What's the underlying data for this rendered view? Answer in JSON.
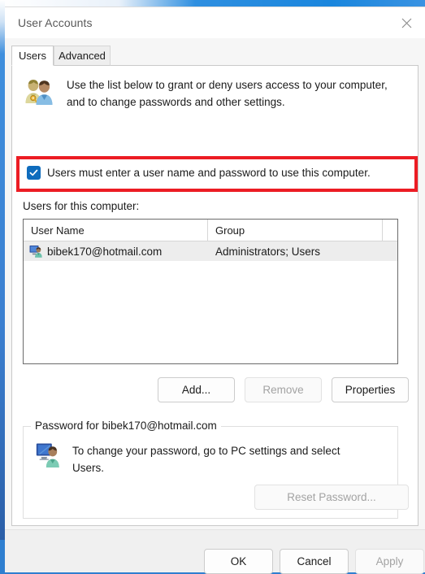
{
  "window": {
    "title": "User Accounts",
    "close_icon": "close-icon"
  },
  "tabs": [
    {
      "label": "Users",
      "selected": true
    },
    {
      "label": "Advanced",
      "selected": false
    }
  ],
  "header": {
    "icon": "two-users-with-key-icon",
    "text": "Use the list below to grant or deny users access to your computer, and to change passwords and other settings."
  },
  "checkbox": {
    "label": "Users must enter a user name and password to use this computer.",
    "checked": true,
    "check_glyph": "checkmark-icon",
    "highlight_color": "#ec1c24",
    "accent_color": "#0f6cbd"
  },
  "users_list": {
    "label": "Users for this computer:",
    "columns": [
      "User Name",
      "Group"
    ],
    "rows": [
      {
        "icon": "user-monitor-icon",
        "user_name": "bibek170@hotmail.com",
        "group": "Administrators; Users",
        "selected": true
      }
    ]
  },
  "list_buttons": {
    "add": {
      "label": "Add...",
      "enabled": true
    },
    "remove": {
      "label": "Remove",
      "enabled": false
    },
    "properties": {
      "label": "Properties",
      "enabled": true
    }
  },
  "password_group": {
    "legend": "Password for bibek170@hotmail.com",
    "icon": "user-monitor-large-icon",
    "text": "To change your password, go to PC settings and select Users.",
    "reset_button": {
      "label": "Reset Password...",
      "enabled": false
    }
  },
  "dialog_buttons": {
    "ok": {
      "label": "OK",
      "enabled": true
    },
    "cancel": {
      "label": "Cancel",
      "enabled": true
    },
    "apply": {
      "label": "Apply",
      "enabled": false
    }
  }
}
